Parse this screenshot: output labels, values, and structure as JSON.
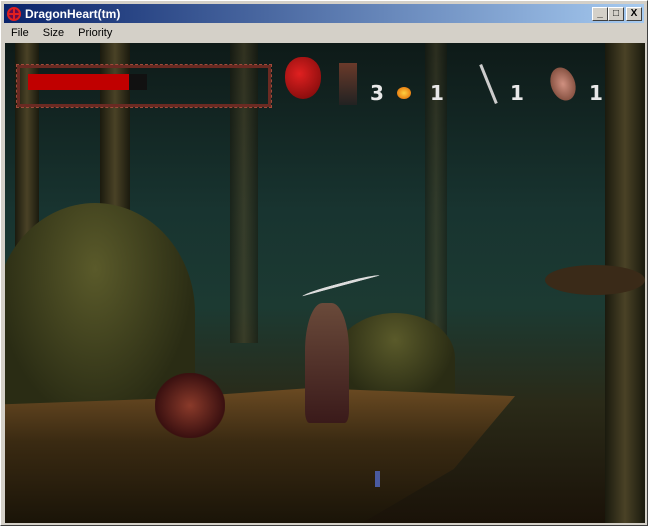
{
  "window": {
    "title": "DragonHeart(tm)",
    "minimize": "_",
    "maximize": "□",
    "close": "X"
  },
  "menu": [
    "File",
    "Size",
    "Priority"
  ],
  "hud": {
    "health_fraction": 0.85,
    "lives": "3",
    "fire_count": "1",
    "dagger_count": "1",
    "shield_count": "1"
  },
  "colors": {
    "health": "#c00000",
    "titlebar_start": "#0a246a",
    "titlebar_end": "#a6caf0"
  }
}
